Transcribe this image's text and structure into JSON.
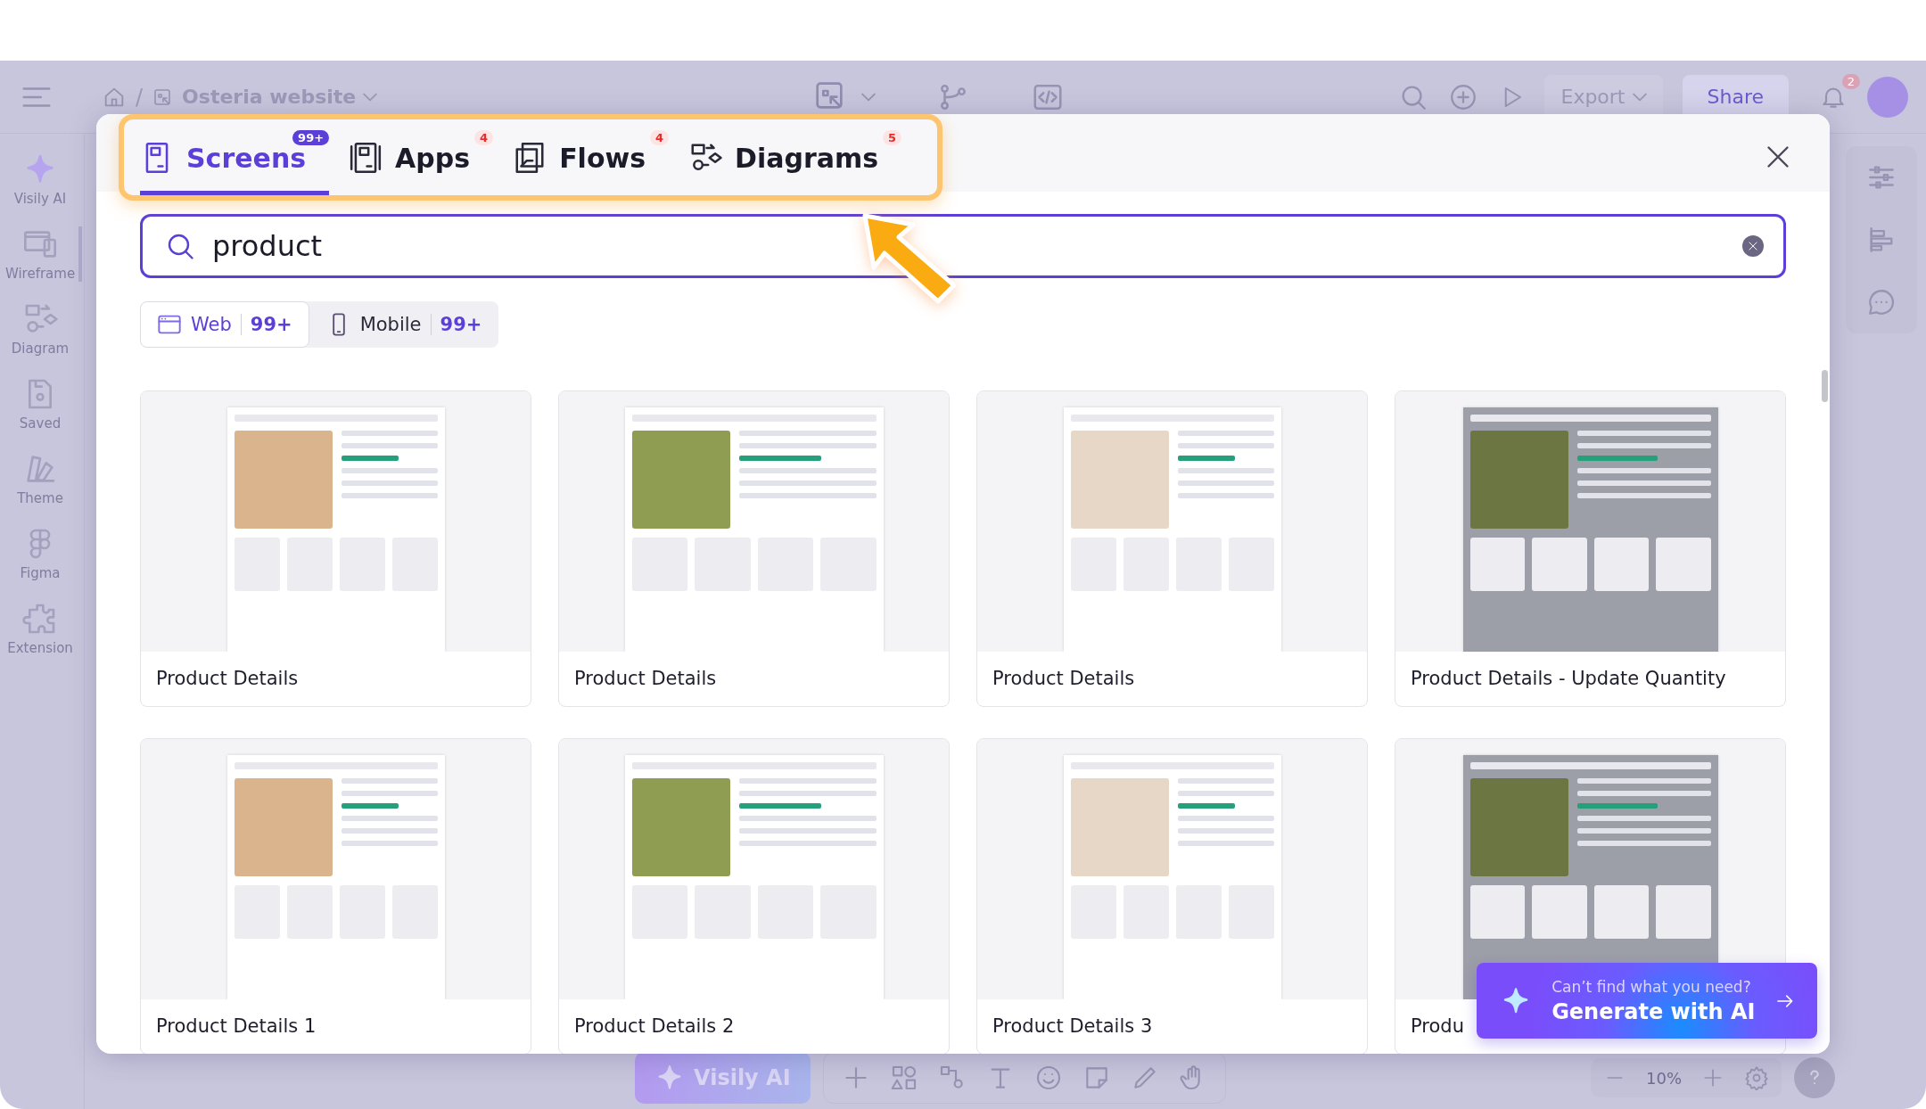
{
  "toolbar": {
    "separator": "/",
    "breadcrumb": "Osteria website",
    "export": "Export",
    "share": "Share",
    "notifications": "2"
  },
  "sidebar": [
    {
      "label": "Visily AI",
      "selected": false
    },
    {
      "label": "Wireframe",
      "selected": true
    },
    {
      "label": "Diagram",
      "selected": false
    },
    {
      "label": "Saved",
      "selected": false
    },
    {
      "label": "Theme",
      "selected": false
    },
    {
      "label": "Figma",
      "selected": false
    },
    {
      "label": "Extension",
      "selected": false
    }
  ],
  "canvas_toolbar": {
    "ai_button": "Visily AI",
    "zoom": "10%"
  },
  "dialog": {
    "tabs": [
      {
        "label": "Screens",
        "badge": "99+",
        "selected": true
      },
      {
        "label": "Apps",
        "badge": "4",
        "selected": false
      },
      {
        "label": "Flows",
        "badge": "4",
        "selected": false
      },
      {
        "label": "Diagrams",
        "badge": "5",
        "selected": false
      }
    ],
    "search": {
      "value": "product"
    },
    "filters": [
      {
        "label": "Web",
        "count": "99+",
        "selected": true
      },
      {
        "label": "Mobile",
        "count": "99+",
        "selected": false
      }
    ],
    "cards": [
      {
        "title": "Product Details"
      },
      {
        "title": "Product Details"
      },
      {
        "title": "Product Details"
      },
      {
        "title": "Product Details - Update Quantity"
      },
      {
        "title": "Product Details 1"
      },
      {
        "title": "Product Details 2"
      },
      {
        "title": "Product Details 3"
      },
      {
        "title": "Produ"
      }
    ],
    "ai_prompt": {
      "hint": "Can’t find what you need?",
      "action": "Generate with AI"
    }
  }
}
